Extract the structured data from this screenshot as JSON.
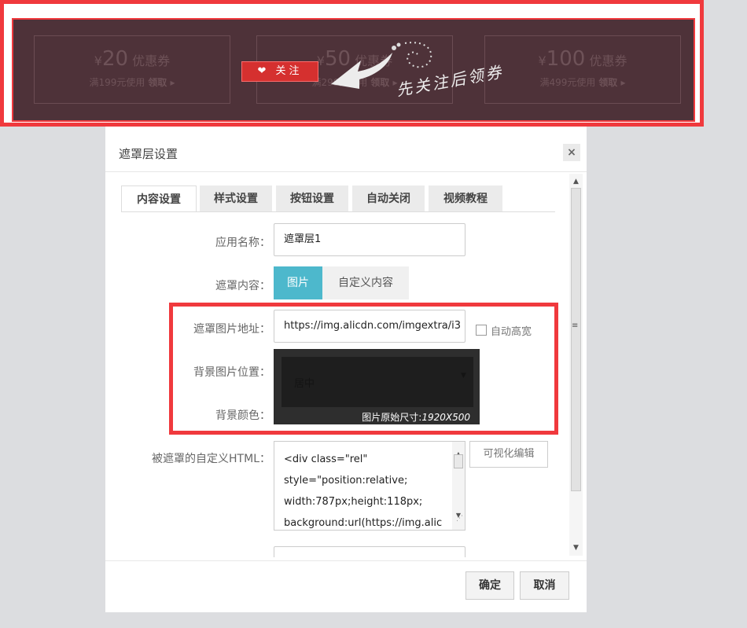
{
  "banner": {
    "coupons": [
      {
        "symbol": "¥",
        "amount": "20",
        "unit": "优惠券",
        "condition": "满199元使用",
        "action": "领取 ▸"
      },
      {
        "symbol": "¥",
        "amount": "50",
        "unit": "优惠券",
        "condition": "满299元使用",
        "action": "领取 ▸"
      },
      {
        "symbol": "¥",
        "amount": "100",
        "unit": "优惠券",
        "condition": "满499元使用",
        "action": "领取 ▸"
      }
    ],
    "follow_label": "关注",
    "hint_text": "先关注后领券"
  },
  "dialog": {
    "title": "遮罩层设置",
    "close_icon": "×",
    "tabs": [
      "内容设置",
      "样式设置",
      "按钮设置",
      "自动关闭",
      "视频教程"
    ],
    "active_tab": "内容设置",
    "form": {
      "app_name_label": "应用名称：",
      "app_name_value": "遮罩层1",
      "mask_content_label": "遮罩内容：",
      "mask_options": [
        "图片",
        "自定义内容"
      ],
      "mask_selected": "图片",
      "image_url_label": "遮罩图片地址：",
      "image_url_value": "https://img.alicdn.com/imgextra/i3",
      "auto_size_label": "自动高宽",
      "bg_position_label": "背景图片位置：",
      "bg_position_value": "居中",
      "bg_color_label": "背景颜色：",
      "preview_caption_prefix": "图片原始尺寸:",
      "preview_caption_size": "1920X500",
      "html_label": "被遮罩的自定义HTML：",
      "html_lines": [
        "<div class=\"rel\"",
        "style=\"position:relative;",
        "width:787px;height:118px;",
        "background:url(https://img.alic"
      ],
      "visual_edit_label": "可视化编辑"
    },
    "buttons": {
      "confirm": "确定",
      "cancel": "取消"
    }
  },
  "colors": {
    "accent": "#4db8cc",
    "highlight_border": "#f0393d",
    "banner_bg": "#4e3239"
  }
}
